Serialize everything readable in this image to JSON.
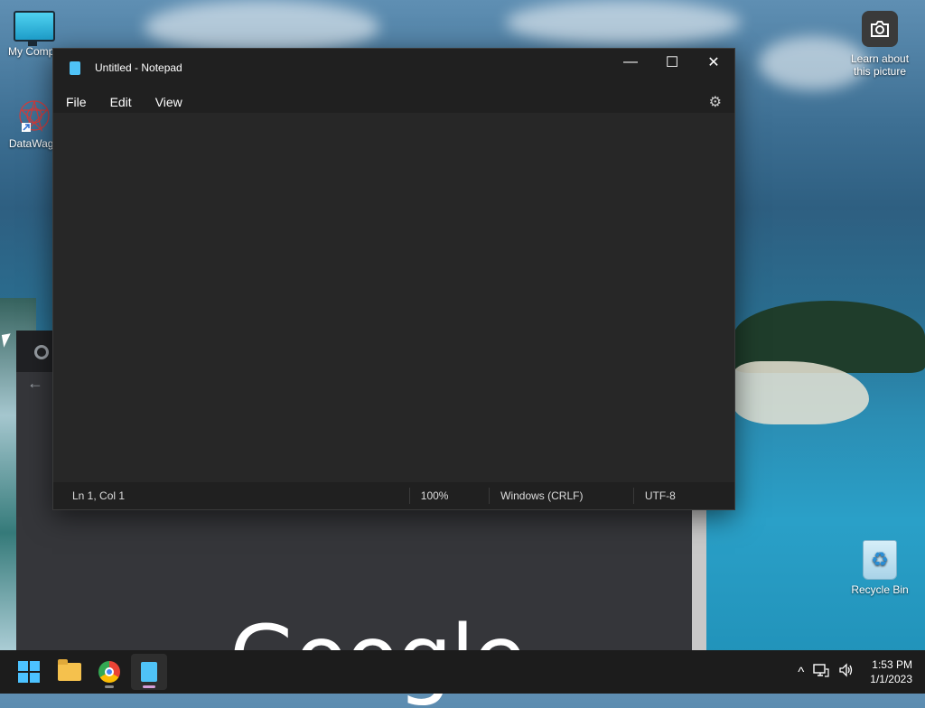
{
  "desktop": {
    "icons": [
      {
        "label": "My Computer",
        "shown": "My Compu"
      },
      {
        "label": "DataWagon",
        "shown": "DataWago"
      },
      {
        "label": "Learn about this picture",
        "line1": "Learn about",
        "line2": "this picture"
      },
      {
        "label": "Recycle Bin"
      }
    ]
  },
  "browser": {
    "logo_text": "Google"
  },
  "notepad": {
    "title": "Untitled - Notepad",
    "menu": [
      "File",
      "Edit",
      "View"
    ],
    "content": "",
    "status": {
      "position": "Ln 1, Col 1",
      "zoom": "100%",
      "line_endings": "Windows (CRLF)",
      "encoding": "UTF-8"
    },
    "controls": {
      "minimize": "—",
      "maximize": "☐",
      "close": "✕"
    }
  },
  "taskbar": {
    "time": "1:53 PM",
    "date": "1/1/2023",
    "tray_chevron": "^"
  },
  "colors": {
    "notepad_bg": "#202020",
    "editor_bg": "#272727",
    "taskbar_bg": "#1c1c1c",
    "accent": "#4cc2ff"
  }
}
